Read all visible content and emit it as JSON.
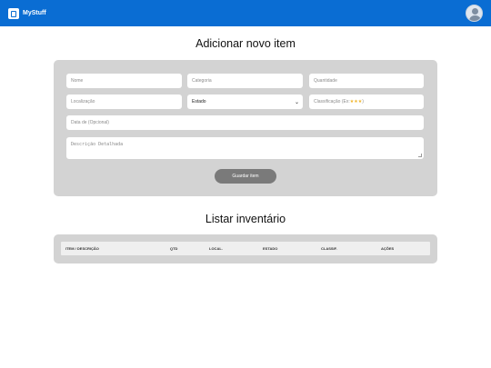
{
  "app": {
    "title": "MyStuff"
  },
  "add_section": {
    "heading": "Adicionar novo item",
    "fields": {
      "nome": "Nome",
      "categoria": "Categoria",
      "quantidade": "Quantidade",
      "localizacao": "Localização",
      "estado": "Estado",
      "classificacao": "Classificação (Ex: ",
      "classificacao_stars": "★★★",
      "classificacao_close": ")",
      "data": "Data de (Opcional)",
      "descricao": "Descrição Detalhada"
    },
    "save_label": "Guardar item"
  },
  "list_section": {
    "heading": "Listar inventário",
    "columns": [
      "ITEM / DESCRIÇÃO",
      "QTD",
      "LOCAL.",
      "ESTADO",
      "CLASSIF.",
      "AÇÕES"
    ]
  },
  "colors": {
    "header": "#0a6dd3",
    "card": "#d3d3d3",
    "button": "#7a7a7a",
    "star": "#f0b429"
  },
  "icons": {
    "logo": "inventory-box-icon",
    "avatar": "user-avatar-icon",
    "select": "chevron-down-icon"
  }
}
